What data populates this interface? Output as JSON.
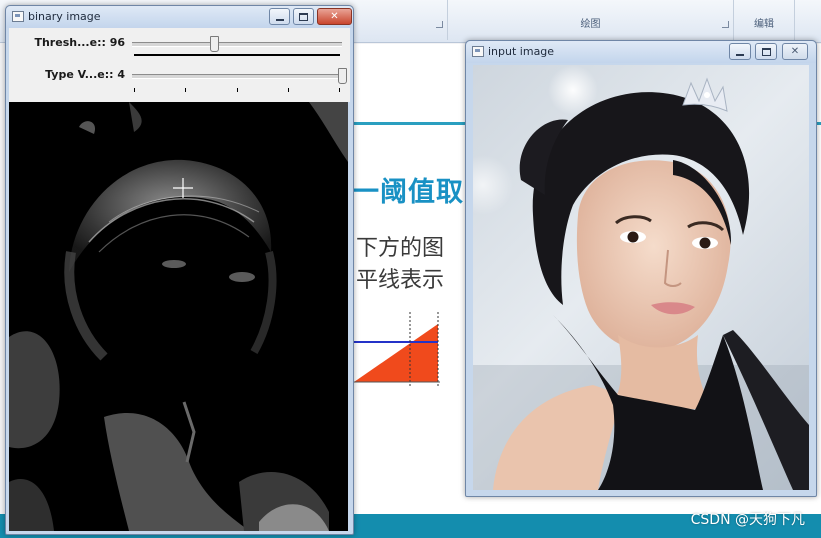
{
  "background_app": {
    "ribbon_groups": [
      "绘图",
      "编辑"
    ],
    "slide_title": "一阈值取",
    "slide_lines": [
      "下方的图",
      "平线表示"
    ]
  },
  "windows": {
    "binary": {
      "title": "binary image",
      "trackbars": [
        {
          "label": "Thresh...e:: 96",
          "value": 96
        },
        {
          "label": "Type V...e:: 4",
          "value": 4
        }
      ]
    },
    "input": {
      "title": "input image"
    }
  },
  "watermark": "CSDN @天狗下凡",
  "colors": {
    "accent": "#1991c4",
    "footer": "#148dae",
    "window_frame": "#c6d7ec",
    "close_button": "#c9452d"
  },
  "icons": [
    "window-app-icon",
    "minimize-icon",
    "maximize-icon",
    "close-icon",
    "crosshair-icon"
  ]
}
